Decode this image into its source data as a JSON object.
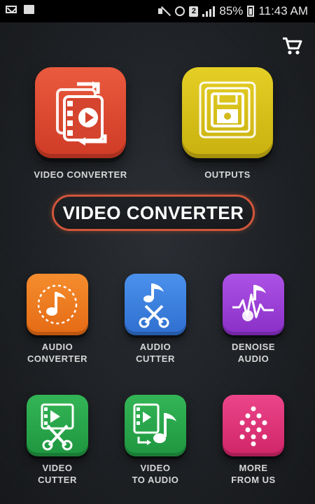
{
  "status_bar": {
    "battery_percent": "85%",
    "time": "11:43 AM",
    "sim_badge": "2",
    "icons": [
      "mail-icon",
      "news-icon",
      "mute-icon",
      "alarm-icon",
      "sim-icon",
      "signal-icon",
      "battery-icon"
    ]
  },
  "toolbar": {
    "cart_icon": "cart-icon"
  },
  "top_tiles": [
    {
      "label": "VIDEO CONVERTER",
      "icon": "video-convert-icon",
      "color": "#e1452f"
    },
    {
      "label": "OUTPUTS",
      "icon": "floppy-disk-icon",
      "color": "#d9c21a"
    }
  ],
  "banner": {
    "title": "VIDEO CONVERTER"
  },
  "grid": [
    {
      "line1": "AUDIO",
      "line2": "CONVERTER",
      "icon": "music-note-icon",
      "color": "#f07a20"
    },
    {
      "line1": "AUDIO",
      "line2": "CUTTER",
      "icon": "audio-scissors-icon",
      "color": "#3f84e0"
    },
    {
      "line1": "DENOISE",
      "line2": "AUDIO",
      "icon": "waveform-icon",
      "color": "#9b3fd6"
    },
    {
      "line1": "VIDEO",
      "line2": "CUTTER",
      "icon": "video-scissors-icon",
      "color": "#27a84a"
    },
    {
      "line1": "VIDEO",
      "line2": "TO AUDIO",
      "icon": "video-to-audio-icon",
      "color": "#27a84a"
    },
    {
      "line1": "MORE",
      "line2": "FROM US",
      "icon": "dots-pattern-icon",
      "color": "#e0337a"
    }
  ]
}
